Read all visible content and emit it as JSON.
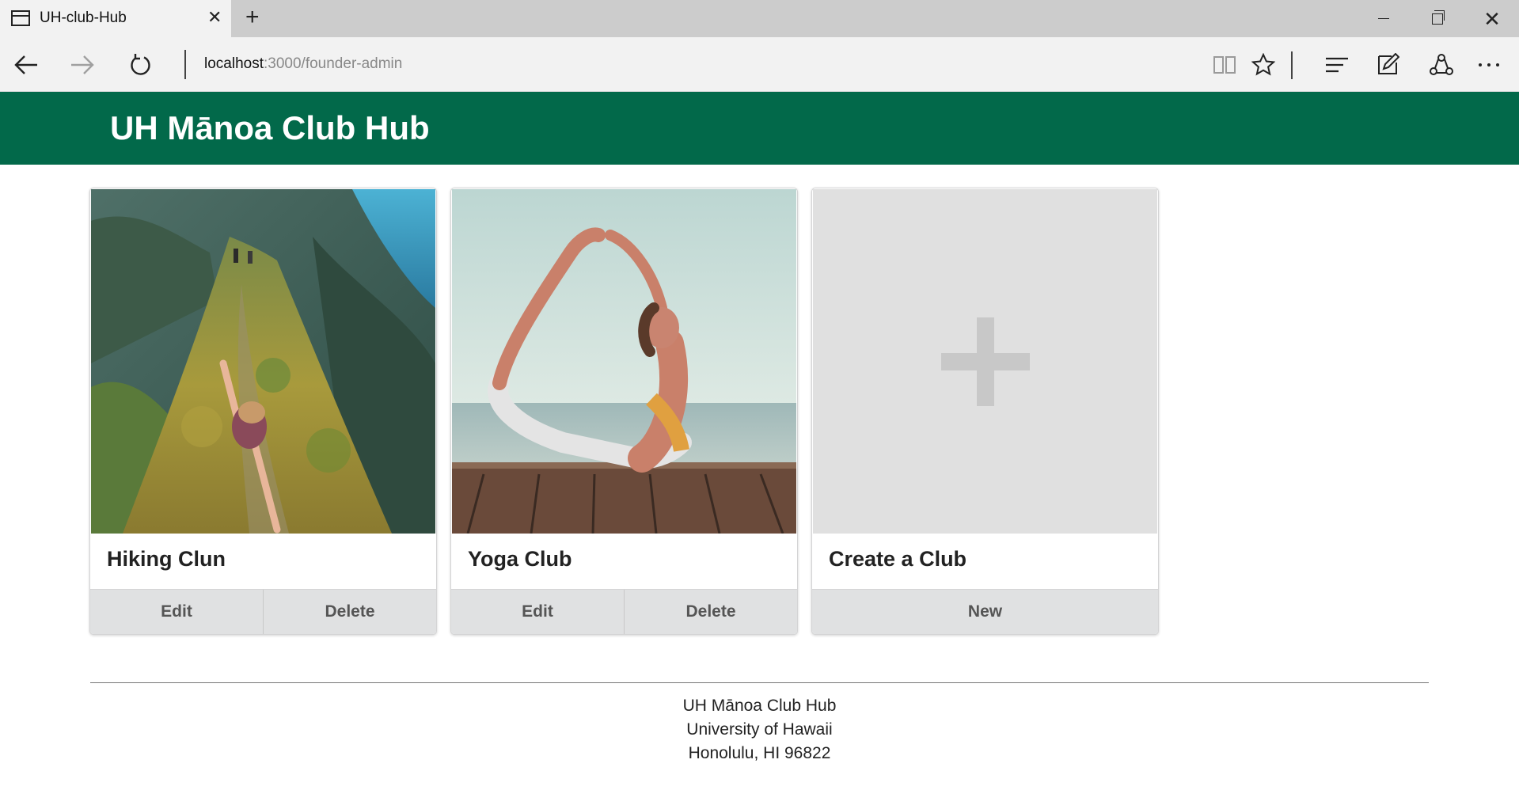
{
  "browser": {
    "tab_title": "UH-club-Hub",
    "url_host": "localhost",
    "url_path": ":3000/founder-admin"
  },
  "header": {
    "title": "UH Mānoa Club Hub"
  },
  "clubs": [
    {
      "name": "Hiking Clun",
      "edit_label": "Edit",
      "delete_label": "Delete",
      "image": "hiking-photo"
    },
    {
      "name": "Yoga Club",
      "edit_label": "Edit",
      "delete_label": "Delete",
      "image": "yoga-photo"
    }
  ],
  "create_card": {
    "name": "Create a Club",
    "button_label": "New",
    "icon": "plus-icon"
  },
  "footer": {
    "line1": "UH Mānoa Club Hub",
    "line2": "University of Hawaii",
    "line3": "Honolulu, HI 96822"
  },
  "colors": {
    "header_bg": "#02694a",
    "button_bg": "#e0e1e2"
  }
}
